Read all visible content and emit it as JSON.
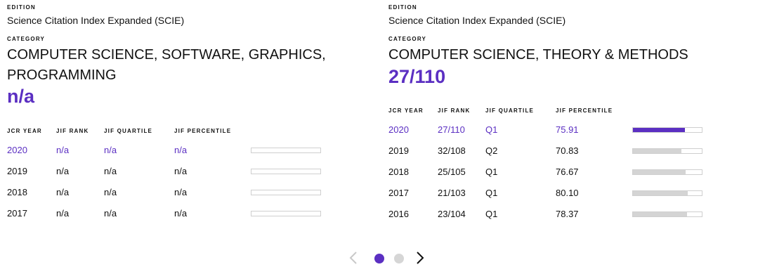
{
  "cards": [
    {
      "edition_label": "EDITION",
      "edition_value": "Science Citation Index Expanded (SCIE)",
      "category_label": "CATEGORY",
      "category_name": "COMPUTER SCIENCE, SOFTWARE, GRAPHICS, PROGRAMMING",
      "rank": "n/a",
      "headers": [
        "JCR YEAR",
        "JIF RANK",
        "JIF QUARTILE",
        "JIF PERCENTILE"
      ],
      "rows": [
        {
          "year": "2020",
          "rank": "n/a",
          "quartile": "n/a",
          "percentile": "n/a",
          "fill": 0,
          "current": true
        },
        {
          "year": "2019",
          "rank": "n/a",
          "quartile": "n/a",
          "percentile": "n/a",
          "fill": 0,
          "current": false
        },
        {
          "year": "2018",
          "rank": "n/a",
          "quartile": "n/a",
          "percentile": "n/a",
          "fill": 0,
          "current": false
        },
        {
          "year": "2017",
          "rank": "n/a",
          "quartile": "n/a",
          "percentile": "n/a",
          "fill": 0,
          "current": false
        }
      ]
    },
    {
      "edition_label": "EDITION",
      "edition_value": "Science Citation Index Expanded (SCIE)",
      "category_label": "CATEGORY",
      "category_name": "COMPUTER SCIENCE, THEORY & METHODS",
      "rank": "27/110",
      "headers": [
        "JCR YEAR",
        "JIF RANK",
        "JIF QUARTILE",
        "JIF PERCENTILE"
      ],
      "rows": [
        {
          "year": "2020",
          "rank": "27/110",
          "quartile": "Q1",
          "percentile": "75.91",
          "fill": 75.91,
          "current": true
        },
        {
          "year": "2019",
          "rank": "32/108",
          "quartile": "Q2",
          "percentile": "70.83",
          "fill": 70.83,
          "current": false
        },
        {
          "year": "2018",
          "rank": "25/105",
          "quartile": "Q1",
          "percentile": "76.67",
          "fill": 76.67,
          "current": false
        },
        {
          "year": "2017",
          "rank": "21/103",
          "quartile": "Q1",
          "percentile": "80.10",
          "fill": 80.1,
          "current": false
        },
        {
          "year": "2016",
          "rank": "23/104",
          "quartile": "Q1",
          "percentile": "78.37",
          "fill": 78.37,
          "current": false
        }
      ]
    }
  ],
  "carousel": {
    "prev_icon": "chevron-left-icon",
    "next_icon": "chevron-right-icon",
    "active_index": 0,
    "dot_count": 2,
    "colors": {
      "accent": "#5b2fc2",
      "inactive_dot": "#d6d6d6",
      "bar_fill": "#d4d4d4"
    }
  }
}
